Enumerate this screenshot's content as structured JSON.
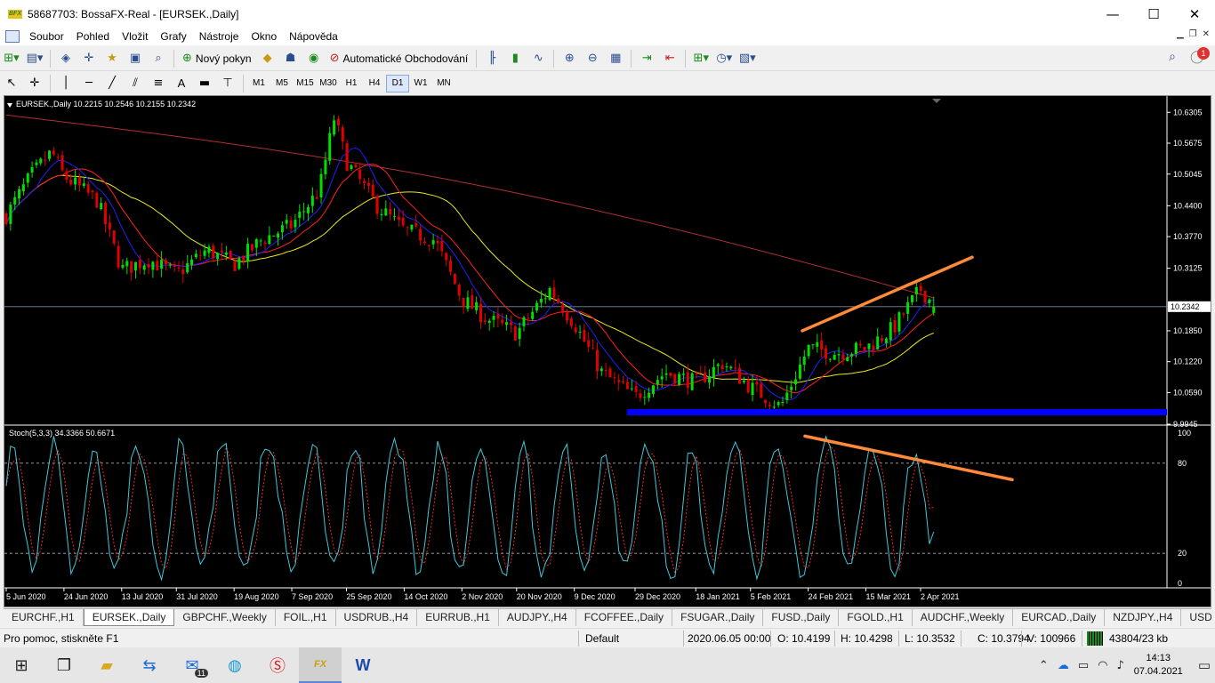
{
  "window": {
    "title": "58687703: BossaFX-Real - [EURSEK.,Daily]",
    "app_icon": "bossafx-logo-icon",
    "app_icon_text": "BFX"
  },
  "menu": [
    "Soubor",
    "Pohled",
    "Vložit",
    "Grafy",
    "Nástroje",
    "Okno",
    "Nápověda"
  ],
  "toolbar": {
    "new_order": "Nový pokyn",
    "autotrading": "Automatické Obchodování",
    "notification_count": "1"
  },
  "timeframes": [
    "M1",
    "M5",
    "M15",
    "M30",
    "H1",
    "H4",
    "D1",
    "W1",
    "MN"
  ],
  "active_timeframe": "D1",
  "chart": {
    "header": "EURSEK.,Daily  10.2215 10.2546 10.2155 10.2342",
    "price_labels": [
      "10.6305",
      "10.5675",
      "10.5045",
      "10.4400",
      "10.3770",
      "10.3125",
      "10.2342",
      "10.1850",
      "10.1220",
      "10.0590",
      "9.9945"
    ],
    "current_price": "10.2342",
    "indicator_header": "Stoch(5,3,3) 34.3366 50.6671",
    "indicator_levels": [
      "100",
      "80",
      "20",
      "0"
    ],
    "date_labels": [
      "5 Jun 2020",
      "24 Jun 2020",
      "13 Jul 2020",
      "31 Jul 2020",
      "19 Aug 2020",
      "7 Sep 2020",
      "25 Sep 2020",
      "14 Oct 2020",
      "2 Nov 2020",
      "20 Nov 2020",
      "9 Dec 2020",
      "29 Dec 2020",
      "18 Jan 2021",
      "5 Feb 2021",
      "24 Feb 2021",
      "15 Mar 2021",
      "2 Apr 2021"
    ],
    "colors": {
      "bull": "#00e000",
      "bear": "#e00000",
      "ma_blue": "#2020ff",
      "ma_red": "#ff2020",
      "ma_yellow": "#e8e820",
      "ma_long": "#b03030",
      "trendline": "#ff8a3a",
      "support": "#0000ff",
      "stoch_main": "#40c8d8",
      "stoch_signal": "#ff3030"
    }
  },
  "chart_data": {
    "type": "candlestick",
    "symbol": "EURSEK.",
    "timeframe": "Daily",
    "ohlc_last": {
      "open": 10.2215,
      "high": 10.2546,
      "low": 10.2155,
      "close": 10.2342
    },
    "ylim": [
      9.9945,
      10.66
    ],
    "close_path": [
      {
        "date": "5 Jun 2020",
        "close": 10.42
      },
      {
        "date": "13 Jun 2020",
        "close": 10.5
      },
      {
        "date": "20 Jun 2020",
        "close": 10.55
      },
      {
        "date": "24 Jun 2020",
        "close": 10.5
      },
      {
        "date": "5 Jul 2020",
        "close": 10.45
      },
      {
        "date": "13 Jul 2020",
        "close": 10.31
      },
      {
        "date": "22 Jul 2020",
        "close": 10.33
      },
      {
        "date": "31 Jul 2020",
        "close": 10.3
      },
      {
        "date": "10 Aug 2020",
        "close": 10.35
      },
      {
        "date": "19 Aug 2020",
        "close": 10.32
      },
      {
        "date": "28 Aug 2020",
        "close": 10.37
      },
      {
        "date": "7 Sep 2020",
        "close": 10.4
      },
      {
        "date": "16 Sep 2020",
        "close": 10.47
      },
      {
        "date": "21 Sep 2020",
        "close": 10.62
      },
      {
        "date": "25 Sep 2020",
        "close": 10.53
      },
      {
        "date": "5 Oct 2020",
        "close": 10.44
      },
      {
        "date": "14 Oct 2020",
        "close": 10.39
      },
      {
        "date": "24 Oct 2020",
        "close": 10.37
      },
      {
        "date": "2 Nov 2020",
        "close": 10.25
      },
      {
        "date": "10 Nov 2020",
        "close": 10.21
      },
      {
        "date": "20 Nov 2020",
        "close": 10.18
      },
      {
        "date": "1 Dec 2020",
        "close": 10.27
      },
      {
        "date": "9 Dec 2020",
        "close": 10.2
      },
      {
        "date": "18 Dec 2020",
        "close": 10.1
      },
      {
        "date": "29 Dec 2020",
        "close": 10.05
      },
      {
        "date": "8 Jan 2021",
        "close": 10.1
      },
      {
        "date": "18 Jan 2021",
        "close": 10.08
      },
      {
        "date": "27 Jan 2021",
        "close": 10.12
      },
      {
        "date": "5 Feb 2021",
        "close": 10.07
      },
      {
        "date": "15 Feb 2021",
        "close": 10.03
      },
      {
        "date": "24 Feb 2021",
        "close": 10.15
      },
      {
        "date": "5 Mar 2021",
        "close": 10.14
      },
      {
        "date": "15 Mar 2021",
        "close": 10.15
      },
      {
        "date": "24 Mar 2021",
        "close": 10.19
      },
      {
        "date": "2 Apr 2021",
        "close": 10.27
      },
      {
        "date": "7 Apr 2021",
        "close": 10.2342
      }
    ],
    "support_level": 10.02,
    "stochastic": {
      "params": "5,3,3",
      "main": 34.3366,
      "signal": 50.6671,
      "levels": [
        80,
        20
      ]
    }
  },
  "tabs": [
    "EURCHF.,H1",
    "EURSEK.,Daily",
    "GBPCHF.,Weekly",
    "FOIL.,H1",
    "USDRUB.,H4",
    "EURRUB.,H1",
    "AUDJPY.,H4",
    "FCOFFEE.,Daily",
    "FSUGAR.,Daily",
    "FUSD.,Daily",
    "FGOLD.,H1",
    "AUDCHF.,Weekly",
    "EURCAD.,Daily",
    "NZDJPY.,H4",
    "USDC"
  ],
  "active_tab": "EURSEK.,Daily",
  "status": {
    "help": "Pro pomoc, stiskněte F1",
    "profile": "Default",
    "datetime": "2020.06.05 00:00",
    "open": "O: 10.4199",
    "high": "H: 10.4298",
    "low": "L: 10.3532",
    "close": "C: 10.3794",
    "volume": "V: 100966",
    "traffic": "43804/23 kb"
  },
  "taskbar": {
    "time": "14:13",
    "date": "07.04.2021",
    "mail_count": "11"
  }
}
